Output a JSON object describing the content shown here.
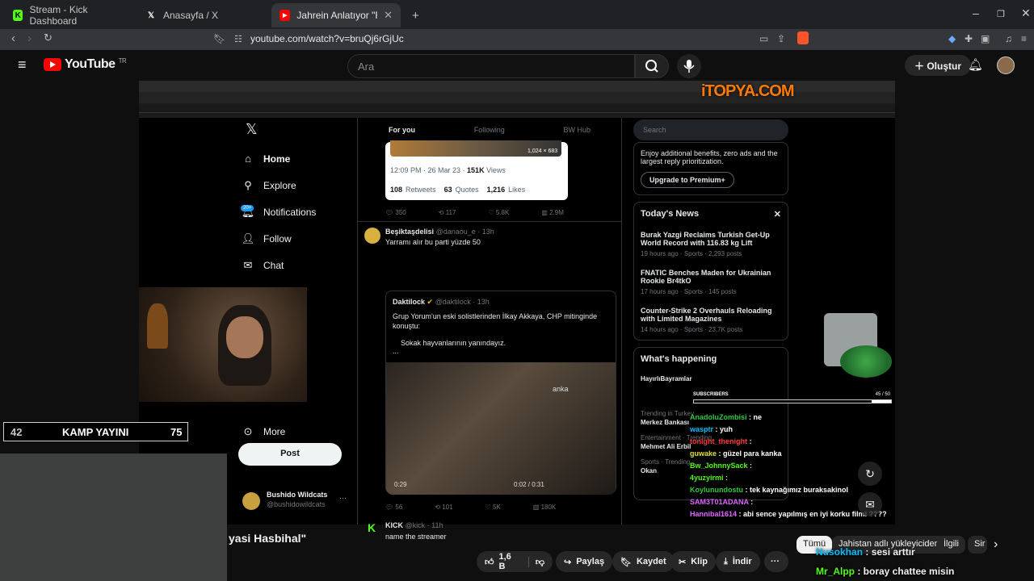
{
  "browser": {
    "tabs": [
      {
        "title": "Stream - Kick Dashboard",
        "icon": "kick-icon"
      },
      {
        "title": "Anasayfa / X",
        "icon": "x-logo-icon"
      },
      {
        "title": "Jahrein Anlatıyor \"Fonlanan H",
        "icon": "youtube-icon"
      }
    ],
    "new_tab": "+",
    "url": "youtube.com/watch?v=bruQj6rGjUc"
  },
  "youtube": {
    "logo": "YouTube",
    "region": "TR",
    "search_placeholder": "Ara",
    "create_label": "Oluştur",
    "title_fragment": "yasi Hasbihal\"",
    "actions": {
      "likes": "1,6 B",
      "share": "Paylaş",
      "save": "Kaydet",
      "clip": "Klip",
      "download": "İndir"
    },
    "chips": [
      "Tümü",
      "Jahistan adlı yükleyiciden",
      "İlgili",
      "Sir"
    ]
  },
  "stream_overlay": {
    "watermark": "iTOPYA.COM",
    "kamp_left": "42",
    "kamp_label": "KAMP YAYINI",
    "kamp_right": "75",
    "subs_label": "SUBSCRIBERS",
    "subs_count": "45 / 50",
    "subs_fraction": 0.9,
    "chat": [
      {
        "user": "AnadoluZombisi",
        "msg": "ne",
        "color": "#2ecc40"
      },
      {
        "user": "wasptr",
        "msg": "yuh",
        "color": "#00bfff"
      },
      {
        "user": "tonight_thenight",
        "msg": "",
        "color": "#ff3b3b"
      },
      {
        "user": "guwake",
        "msg": "güzel para kanka",
        "color": "#e0e040"
      },
      {
        "user": "Bw_JohnnySack",
        "msg": "",
        "color": "#53fc18"
      },
      {
        "user": "4yuzyirmi",
        "msg": "",
        "color": "#53fc18"
      },
      {
        "user": "Koylunundostu",
        "msg": "tek kaynağımız buraksakinol",
        "color": "#2ecc40"
      },
      {
        "user": "SAM3T01ADANA",
        "msg": "",
        "color": "#e066ff"
      },
      {
        "user": "Hannibal1614",
        "msg": "abi sence yapılmış en iyi korku filmi ????",
        "color": "#e066ff"
      }
    ],
    "bottom_chat": [
      {
        "user": "Nusokhan",
        "msg": "sesi arttır"
      },
      {
        "user": "Mr_Alpp",
        "msg": "boray chattee misin"
      }
    ]
  },
  "x_page": {
    "nav": [
      "Home",
      "Explore",
      "Notifications",
      "Follow",
      "Chat",
      "More"
    ],
    "notif_badge": "20+",
    "post_button": "Post",
    "account_name": "Bushido Wildcats",
    "account_handle": "@bushidowildcats",
    "feed_tabs": [
      "For you",
      "Following",
      "BW Hub"
    ],
    "top_card": {
      "img_size": "1,024 × 683",
      "time": "12:09 PM · 26 Mar 23",
      "views_num": "151K",
      "views": "Views",
      "retweets_num": "108",
      "retweets": "Retweets",
      "quotes_num": "63",
      "quotes": "Quotes",
      "likes_num": "1,216",
      "likes": "Likes"
    },
    "stats1": [
      "350",
      "117",
      "5.8K",
      "2.9M"
    ],
    "tweet1": {
      "name": "Beşiktaşdelisi",
      "handle": "@danaou_e · 13h",
      "text": "Yarramı alır bu parti yüzde 50"
    },
    "quote": {
      "name": "Daktilock",
      "handle": "@daktilock · 13h",
      "text": "Grup Yorum'un eski solistlerinden İlkay Akkaya, CHP mitinginde konuştu:",
      "sub": "Sokak hayvanlarının yanındayız.",
      "ellipsis": "...",
      "time_left": "0:29",
      "time_right": "0:02 / 0:31",
      "brand": "anka"
    },
    "stats2": [
      "56",
      "101",
      "5K",
      "180K"
    ],
    "tweet2": {
      "name": "KICK",
      "handle": "@kick · 11h",
      "text": "name the streamer"
    },
    "search_placeholder": "Search",
    "premium_text": "Enjoy additional benefits, zero ads and the largest reply prioritization.",
    "premium_button": "Upgrade to Premium+",
    "news_title": "Today's News",
    "news": [
      {
        "headline": "Burak Yazgi Reclaims Turkish Get-Up World Record with 116.83 kg Lift",
        "meta": "19 hours ago · Sports · 2,293 posts"
      },
      {
        "headline": "FNATIC Benches Maden for Ukrainian Rookie Br4tkO",
        "meta": "17 hours ago · Sports · 145 posts"
      },
      {
        "headline": "Counter-Strike 2 Overhauls Reloading with Limited Magazines",
        "meta": "14 hours ago · Sports · 23.7K posts"
      }
    ],
    "happening_title": "What's happening",
    "happening": [
      {
        "sub": "",
        "head": "HayırlıBayramlar"
      },
      {
        "sub": "Trending in Turkey",
        "head": "Merkez Bankası"
      },
      {
        "sub": "Entertainment · Trending",
        "head": "Mehmet Ali Erbil"
      },
      {
        "sub": "Sports · Trending",
        "head": "Okan"
      }
    ]
  }
}
